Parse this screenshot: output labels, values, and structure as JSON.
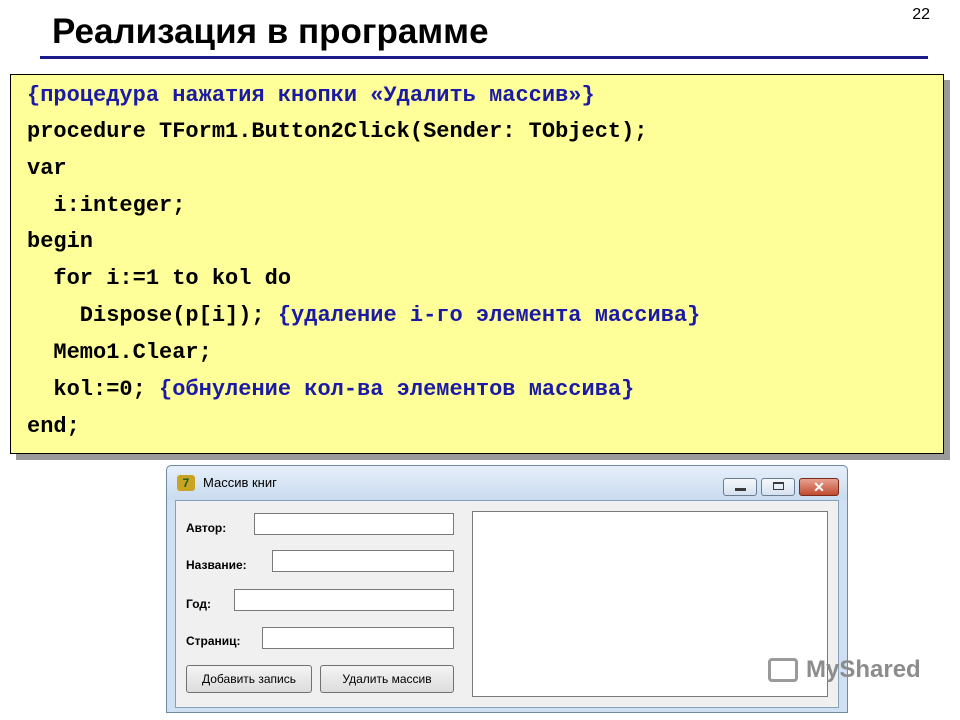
{
  "slide": {
    "title": "Реализация в программе",
    "number": "22"
  },
  "code": {
    "line1": "{процедура нажатия кнопки «Удалить массив»}",
    "line2": "procedure TForm1.Button2Click(Sender: TObject);",
    "line3": "var",
    "line4": "  i:integer;",
    "line5": "begin",
    "line6": "  for i:=1 to kol do",
    "line7_code": "    Dispose(p[i]); ",
    "line7_comment": "{удаление i-го элемента массива}",
    "line8": "  Memo1.Clear;",
    "line9_code": "  kol:=0; ",
    "line9_comment": "{обнуление кол-ва элементов массива}",
    "line10": "end;"
  },
  "window": {
    "title": "Массив книг",
    "labels": {
      "author": "Автор:",
      "name": "Название:",
      "year": "Год:",
      "pages": "Страниц:"
    },
    "buttons": {
      "add": "Добавить запись",
      "delete": "Удалить массив"
    },
    "close_glyph": "✕"
  },
  "watermark": {
    "text": "MyShared"
  }
}
